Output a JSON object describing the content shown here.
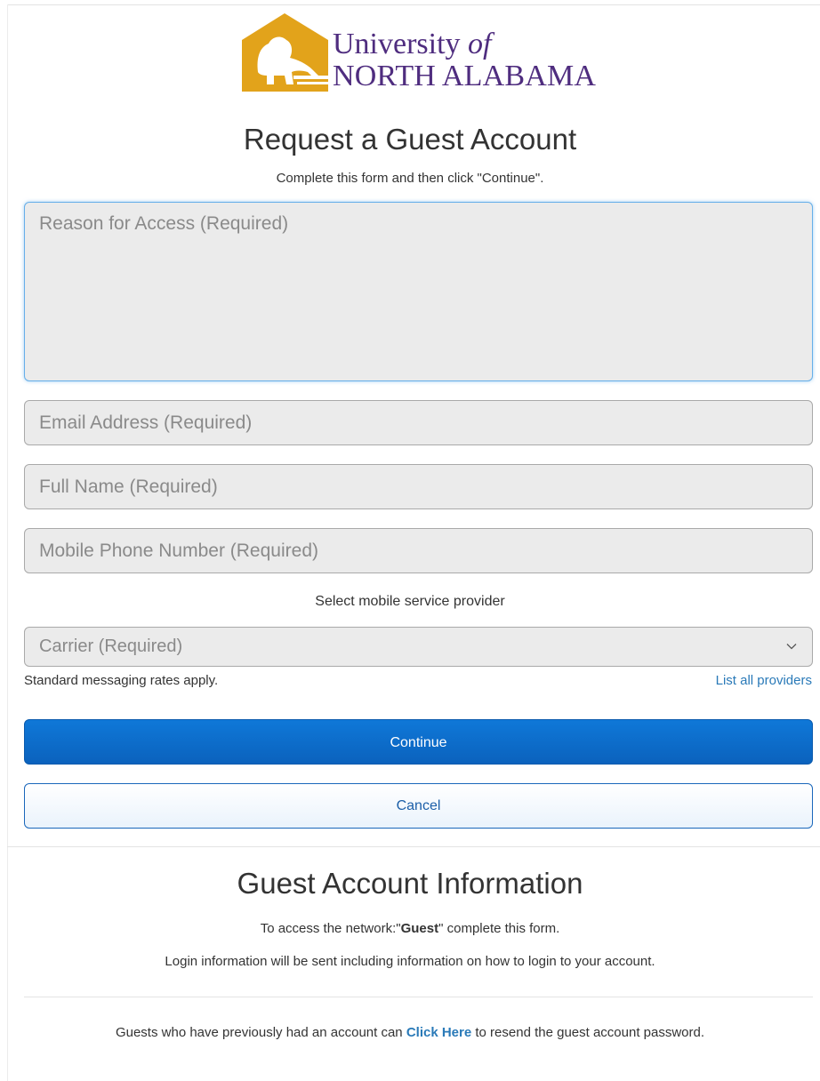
{
  "logo": {
    "line1_main": "University",
    "line1_of": "of",
    "line2": "NORTH ALABAMA",
    "mark_icon": "lion-logo-icon",
    "gold_color": "#e2a31b",
    "purple_color": "#4f2d7f"
  },
  "form": {
    "title": "Request a Guest Account",
    "subtitle": "Complete this form and then click \"Continue\".",
    "reason_placeholder": "Reason for Access (Required)",
    "email_placeholder": "Email Address (Required)",
    "name_placeholder": "Full Name (Required)",
    "phone_placeholder": "Mobile Phone Number (Required)",
    "provider_label": "Select mobile service provider",
    "carrier_selected": "Carrier (Required)",
    "carrier_icon": "chevron-down-icon",
    "rates_note": "Standard messaging rates apply.",
    "list_providers_link": "List all providers",
    "continue_label": "Continue",
    "cancel_label": "Cancel",
    "accent_color": "#0b6fd1"
  },
  "info": {
    "title": "Guest Account Information",
    "line1_pre": "To access the network:\"",
    "line1_network": "Guest",
    "line1_post": "\" complete this form.",
    "line2": "Login information will be sent including information on how to login to your account.",
    "resend_pre": "Guests who have previously had an account can ",
    "resend_link": "Click Here",
    "resend_post": " to resend the guest account password."
  }
}
